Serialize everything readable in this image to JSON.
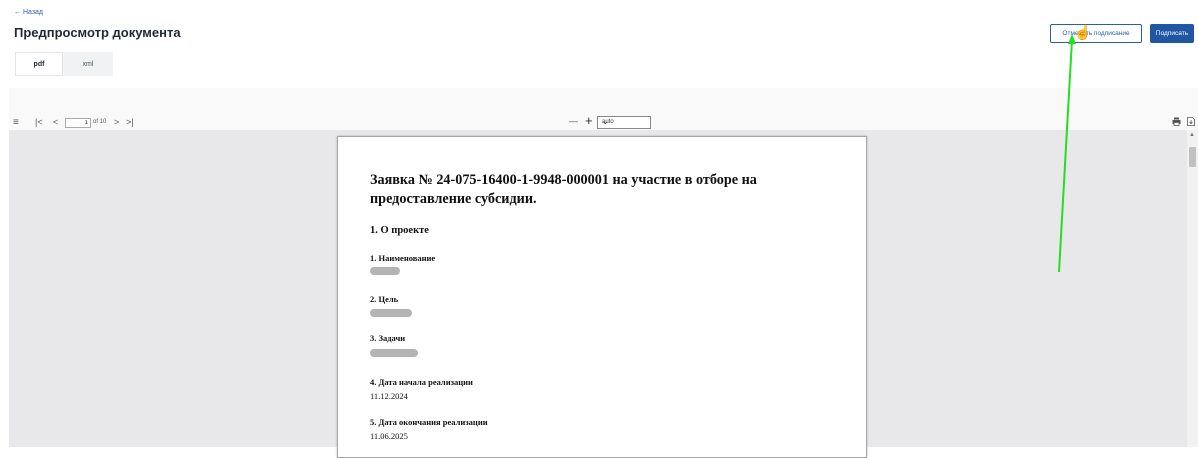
{
  "header": {
    "back": "← Назад",
    "title": "Предпросмотр документа",
    "cancel_sign_button": "Отменить подписание",
    "sign_button": "Подписать"
  },
  "tabs": [
    {
      "label": "pdf",
      "active": true
    },
    {
      "label": "xml",
      "active": false
    }
  ],
  "viewer": {
    "toolbar": {
      "sidebar_toggle": "≡",
      "first_page": "|<",
      "prev_page": "<",
      "current_page": "1",
      "page_total": "of 10",
      "next_page": ">",
      "last_page": ">|",
      "zoom_out": "—",
      "zoom_in": "+",
      "zoom_value": "auto",
      "print_icon": "printer-icon",
      "download_icon": "download-icon"
    },
    "document": {
      "title": "Заявка № 24-075-16400-1-9948-000001 на участие в отборе на предоставление субсидии.",
      "section1": "1. О проекте",
      "fields": [
        {
          "label": "1. Наименование",
          "value": "",
          "redacted": true
        },
        {
          "label": "2. Цель",
          "value": "",
          "redacted": true
        },
        {
          "label": "3. Задачи",
          "value": "",
          "redacted": true
        },
        {
          "label": "4. Дата начала реализации",
          "value": "11.12.2024",
          "redacted": false
        },
        {
          "label": "5. Дата окончания реализации",
          "value": "11.06.2025",
          "redacted": false
        }
      ]
    }
  },
  "colors": {
    "accent": "#1f57a5",
    "annotation_arrow": "#22e01f"
  }
}
